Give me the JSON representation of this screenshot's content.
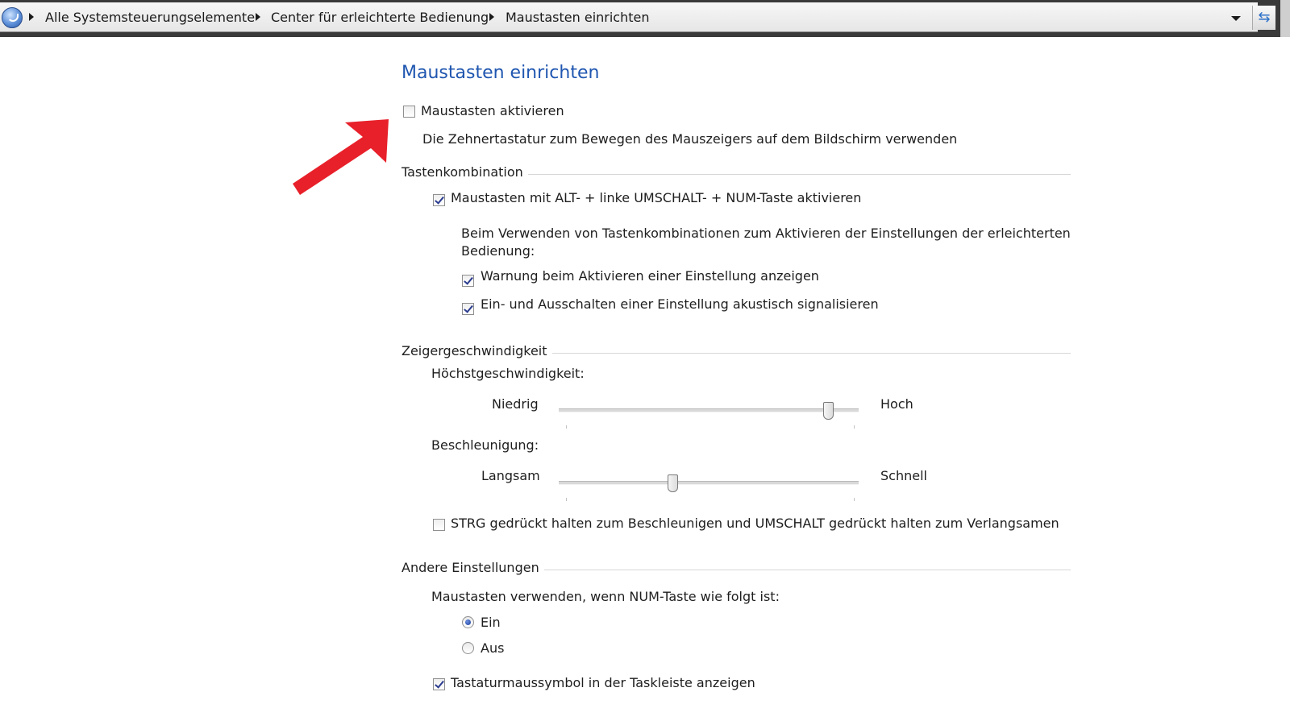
{
  "breadcrumb": {
    "items": [
      "Alle Systemsteuerungselemente",
      "Center für erleichterte Bedienung",
      "Maustasten einrichten"
    ]
  },
  "page": {
    "title": "Maustasten einrichten",
    "enable_mousekeys": {
      "label": "Maustasten aktivieren",
      "checked": false
    },
    "enable_description": "Die Zehnertastatur zum Bewegen des Mauszeigers auf dem Bildschirm verwenden"
  },
  "shortcut_section": {
    "heading": "Tastenkombination",
    "shortcut_option": {
      "label": "Maustasten mit ALT- + linke UMSCHALT- + NUM-Taste aktivieren",
      "checked": true
    },
    "info_line1": "Beim Verwenden von Tastenkombinationen zum Aktivieren der Einstellungen der erleichterten",
    "info_line2": "Bedienung:",
    "warning_option": {
      "label": "Warnung beim Aktivieren einer Einstellung anzeigen",
      "checked": true
    },
    "sound_option": {
      "label": "Ein- und Ausschalten einer Einstellung akustisch signalisieren",
      "checked": true
    }
  },
  "speed_section": {
    "heading": "Zeigergeschwindigkeit",
    "top_speed": {
      "label": "Höchstgeschwindigkeit:",
      "min_label": "Niedrig",
      "max_label": "Hoch",
      "value_fraction": 0.9
    },
    "acceleration": {
      "label": "Beschleunigung:",
      "min_label": "Langsam",
      "max_label": "Schnell",
      "value_fraction": 0.38
    },
    "ctrl_shift_option": {
      "label": "STRG gedrückt halten zum Beschleunigen und UMSCHALT gedrückt halten zum Verlangsamen",
      "checked": false
    }
  },
  "other_section": {
    "heading": "Andere Einstellungen",
    "numlock_label": "Maustasten verwenden, wenn NUM-Taste wie folgt ist:",
    "radio_on": {
      "label": "Ein",
      "selected": true
    },
    "radio_off": {
      "label": "Aus",
      "selected": false
    },
    "taskbar_option": {
      "label": "Tastaturmaussymbol in der Taskleiste anzeigen",
      "checked": true
    }
  },
  "colors": {
    "title": "#1f56b0",
    "annotation_arrow": "#e8202a"
  },
  "icons": [
    "back-globe-icon",
    "chevron-right-icon",
    "chevron-down-icon",
    "refresh-icon",
    "red-arrow-icon"
  ]
}
